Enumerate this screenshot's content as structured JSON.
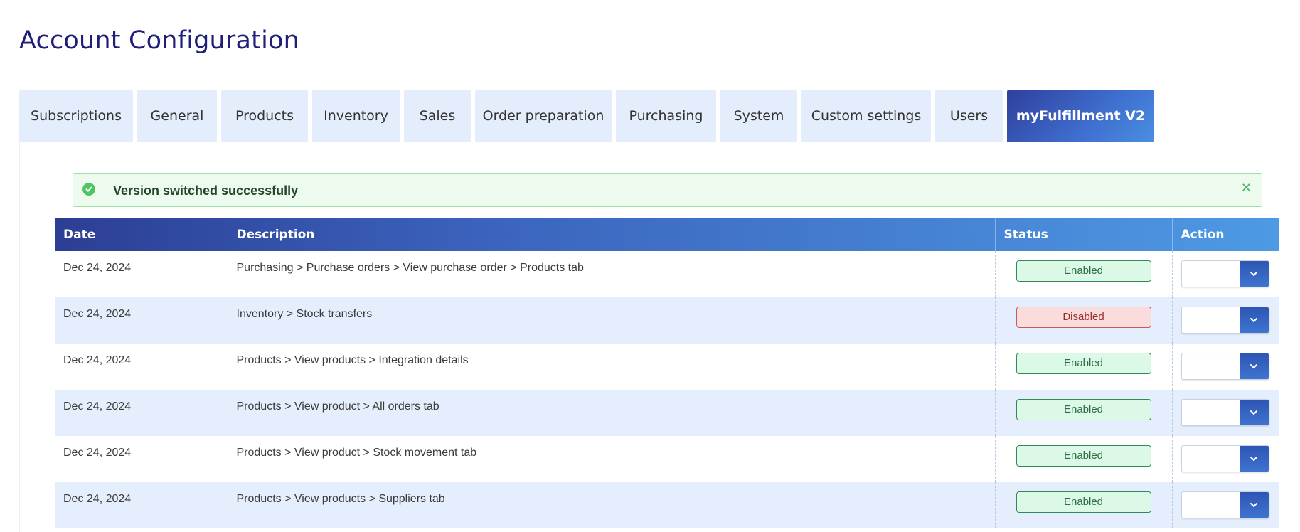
{
  "page": {
    "title": "Account Configuration"
  },
  "tabs": [
    {
      "label": "Subscriptions",
      "active": false
    },
    {
      "label": "General",
      "active": false
    },
    {
      "label": "Products",
      "active": false
    },
    {
      "label": "Inventory",
      "active": false
    },
    {
      "label": "Sales",
      "active": false
    },
    {
      "label": "Order preparation",
      "active": false
    },
    {
      "label": "Purchasing",
      "active": false
    },
    {
      "label": "System",
      "active": false
    },
    {
      "label": "Custom settings",
      "active": false
    },
    {
      "label": "Users",
      "active": false
    },
    {
      "label": "myFulfillment V2",
      "active": true
    }
  ],
  "alert": {
    "message": "Version switched successfully",
    "icon": "check-circle-icon",
    "close_icon": "close-icon"
  },
  "table": {
    "columns": {
      "date": "Date",
      "description": "Description",
      "status": "Status",
      "action": "Action"
    },
    "rows": [
      {
        "date": "Dec 24, 2024",
        "description": "Purchasing > Purchase orders > View purchase order > Products tab",
        "status": "Enabled"
      },
      {
        "date": "Dec 24, 2024",
        "description": "Inventory > Stock transfers",
        "status": "Disabled"
      },
      {
        "date": "Dec 24, 2024",
        "description": "Products > View products > Integration details",
        "status": "Enabled"
      },
      {
        "date": "Dec 24, 2024",
        "description": "Products > View product > All orders tab",
        "status": "Enabled"
      },
      {
        "date": "Dec 24, 2024",
        "description": "Products > View product > Stock movement tab",
        "status": "Enabled"
      },
      {
        "date": "Dec 24, 2024",
        "description": "Products > View products > Suppliers tab",
        "status": "Enabled"
      }
    ]
  },
  "colors": {
    "title": "#1f1f7a",
    "tab_bg": "#e4edfb",
    "tab_active": "#3f6fd0",
    "enabled_bg": "#dcf8e6",
    "disabled_bg": "#fadcdc",
    "alert_bg": "#edfbef"
  }
}
